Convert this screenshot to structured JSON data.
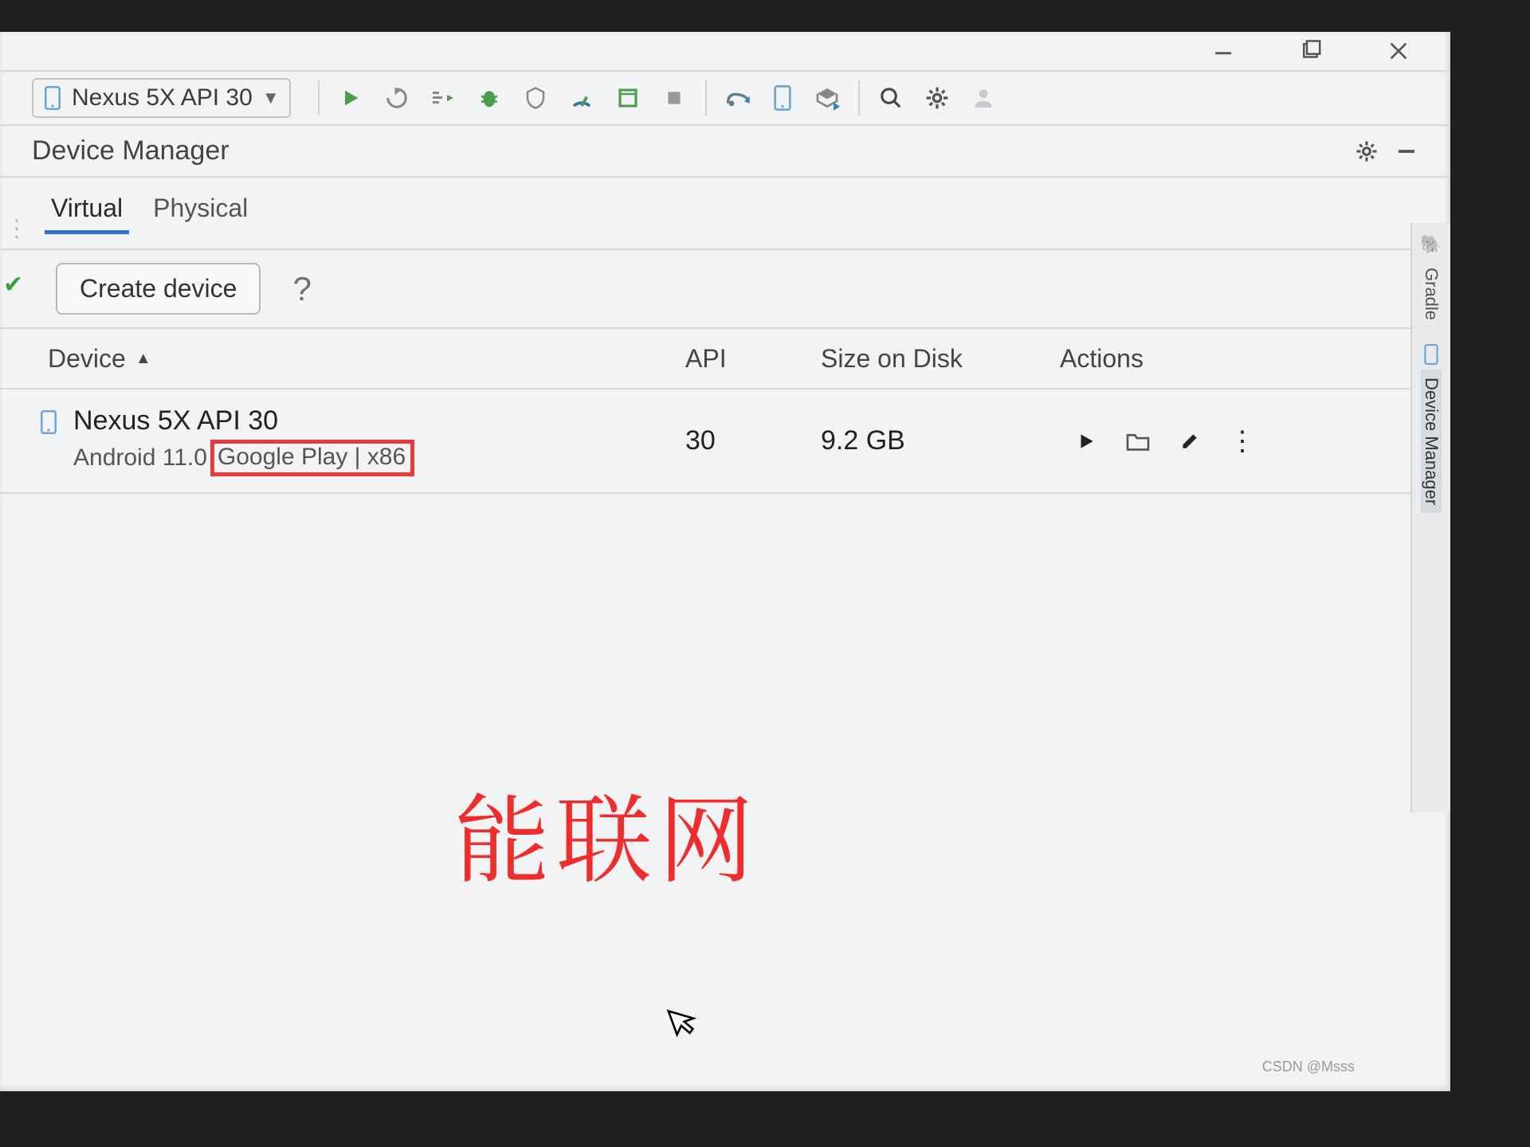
{
  "toolbar": {
    "selected_device": "Nexus 5X API 30"
  },
  "panel": {
    "title": "Device Manager"
  },
  "tabs": {
    "virtual": "Virtual",
    "physical": "Physical"
  },
  "buttons": {
    "create_device": "Create device",
    "help": "?"
  },
  "table": {
    "headers": {
      "device": "Device",
      "api": "API",
      "size": "Size on Disk",
      "actions": "Actions"
    },
    "rows": [
      {
        "name": "Nexus 5X API 30",
        "subtitle_prefix": "Android 11.0",
        "subtitle_highlight": "Google Play | x86",
        "api": "30",
        "size": "9.2 GB"
      }
    ]
  },
  "side": {
    "gradle": "Gradle",
    "device_manager": "Device Manager"
  },
  "annotation": "能联网",
  "watermark": "CSDN @Msss"
}
